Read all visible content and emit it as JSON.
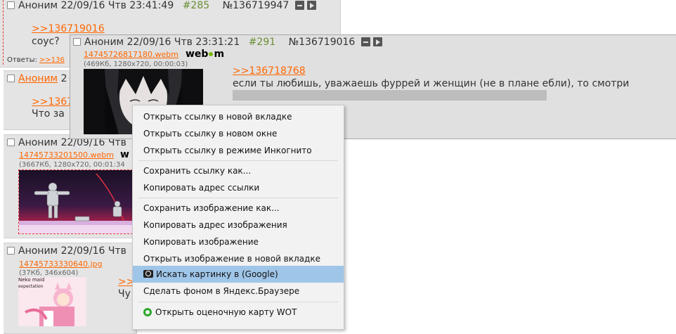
{
  "post1": {
    "name": "Аноним",
    "date": "22/09/16 Чтв 23:41:49",
    "num": "#285",
    "id": "№136719947",
    "ref": ">>136719016",
    "text": "соус?",
    "answers_label": "Ответы:",
    "answers_ref": ">>136"
  },
  "post2": {
    "name": "Аноним",
    "date_partial": "2",
    "ref_partial": ">>1367",
    "text_partial": "Что за"
  },
  "post3": {
    "name": "Аноним",
    "date_partial": "22/09/16 Чтв",
    "file": "14745733201500.webm",
    "webm_partial": "w",
    "fileinfo": "(3667Кб, 1280x720, 00:01:34"
  },
  "post4": {
    "name": "Аноним",
    "date_partial": "22/09/16 Чтв",
    "file": "14745733330640.jpg",
    "fileinfo": "(37Кб, 346x604)",
    "thumb_text_1": "Neko maid",
    "thumb_text_2": "expectation",
    "ref_partial": ">>",
    "text_partial": "Чу"
  },
  "preview": {
    "name": "Аноним",
    "date": "22/09/16 Чтв 23:31:21",
    "num": "#291",
    "id": "№136719016",
    "file": "14745726817180.webm",
    "webm_logo": [
      "web",
      "m"
    ],
    "fileinfo": "(469Кб, 1280x720, 00:00:03)",
    "ref": ">>136718768",
    "text": "если ты любишь, уважаешь фуррей и женщин (не в плане ебли), то смотри"
  },
  "context_menu": {
    "groups": [
      [
        "Открыть ссылку в новой вкладке",
        "Открыть ссылку в новом окне",
        "Открыть ссылку в режиме Инкогнито"
      ],
      [
        "Сохранить ссылку как...",
        "Копировать адрес ссылки"
      ],
      [
        "Сохранить изображение как...",
        "Копировать адрес изображения",
        "Копировать изображение",
        "Открыть изображение в новой вкладке",
        "Искать картинку в (Google)",
        "Сделать фоном в Яндекс.Браузере"
      ],
      [
        "Открыть оценочную карту WOT"
      ]
    ],
    "highlighted": "Искать картинку в (Google)",
    "icons": {
      "google_search": "camera-lens-icon",
      "wot": "wot-circle-icon"
    },
    "highlight_color": "#9fc5e8"
  }
}
